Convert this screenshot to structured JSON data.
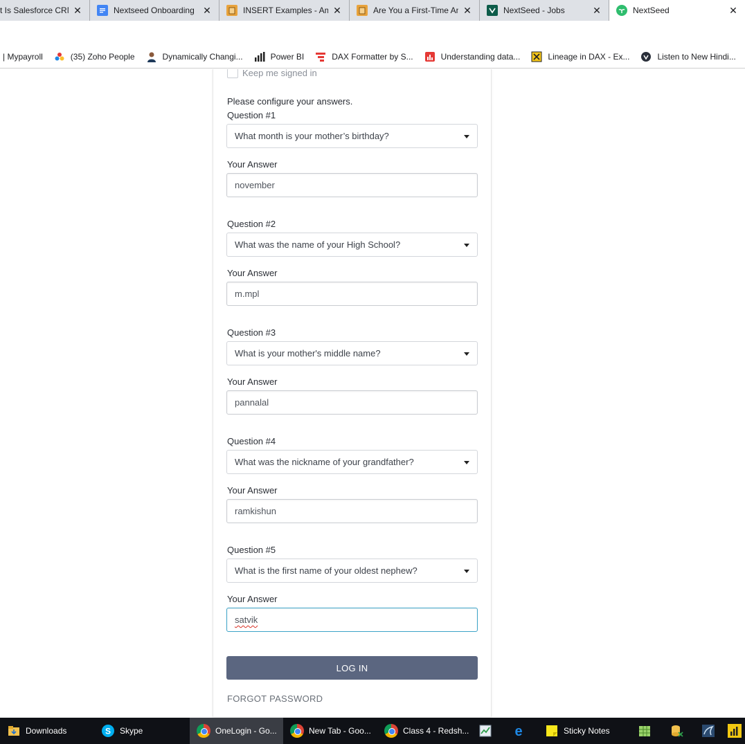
{
  "browser": {
    "tabs": [
      {
        "title": "t Is Salesforce CRM",
        "icon": "generic-page-icon"
      },
      {
        "title": "Nextseed Onboarding",
        "icon": "google-docs-icon"
      },
      {
        "title": "INSERT Examples - Ama",
        "icon": "book-icon"
      },
      {
        "title": "Are You a First-Time An",
        "icon": "book-icon"
      },
      {
        "title": "NextSeed - Jobs",
        "icon": "nextseed-jobs-icon"
      },
      {
        "title": "NextSeed",
        "icon": "nextseed-sprout-icon"
      }
    ],
    "tab_close": "✕",
    "bookmarks": [
      {
        "label": "| Mypayroll",
        "icon": ""
      },
      {
        "label": "(35) Zoho People",
        "icon": "zoho-icon"
      },
      {
        "label": "Dynamically Changi...",
        "icon": "person-icon"
      },
      {
        "label": "Power BI",
        "icon": "power-bi-icon"
      },
      {
        "label": "DAX Formatter by S...",
        "icon": "dax-formatter-icon"
      },
      {
        "label": "Understanding data...",
        "icon": "chart-icon"
      },
      {
        "label": "Lineage in DAX - Ex...",
        "icon": "excel-icon"
      },
      {
        "label": "Listen to New Hindi...",
        "icon": "music-icon"
      }
    ]
  },
  "form": {
    "keep_signed_in": "Keep me signed in",
    "intro": "Please configure your answers.",
    "answer_label": "Your Answer",
    "questions": [
      {
        "label": "Question #1",
        "question": "What month is your mother’s birthday?",
        "answer": "november"
      },
      {
        "label": "Question #2",
        "question": "What was the name of your High School?",
        "answer": "m.mpl"
      },
      {
        "label": "Question #3",
        "question": "What is your mother's middle name?",
        "answer": "pannalal"
      },
      {
        "label": "Question #4",
        "question": "What was the nickname of your grandfather?",
        "answer": "ramkishun"
      },
      {
        "label": "Question #5",
        "question": "What is the first name of your oldest nephew?",
        "answer": "satvik"
      }
    ],
    "login_button": "LOG IN",
    "forgot_password": "FORGOT PASSWORD"
  },
  "taskbar": {
    "items": [
      {
        "label": "Downloads",
        "icon": "folder-icon"
      },
      {
        "label": "Skype",
        "icon": "skype-icon"
      },
      {
        "label": "OneLogin - Go...",
        "icon": "chrome-icon"
      },
      {
        "label": "New Tab - Goo...",
        "icon": "chrome-icon"
      },
      {
        "label": "Class 4 - Redsh...",
        "icon": "chrome-icon"
      },
      {
        "label": "",
        "icon": "task-manager-icon"
      },
      {
        "label": "",
        "icon": "edge-icon"
      },
      {
        "label": "Sticky Notes",
        "icon": "sticky-notes-icon"
      }
    ]
  },
  "colors": {
    "login_button": "#5b6680",
    "active_field_border": "#3ca3c8",
    "taskbar": "#0f1116"
  }
}
